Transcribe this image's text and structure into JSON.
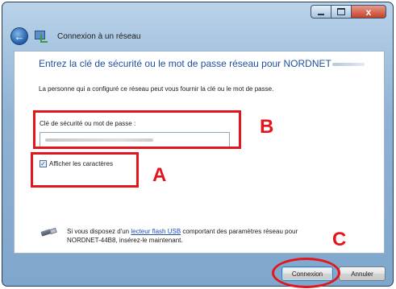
{
  "window": {
    "title": "Connexion à un réseau",
    "controls": {
      "close_glyph": "x"
    }
  },
  "content": {
    "instruction": "Entrez la clé de sécurité ou le mot de passe réseau pour NORDNET",
    "description": "La personne qui a configuré ce réseau peut vous fournir la clé ou le mot de passe.",
    "field_label": "Clé de sécurité ou mot de passe :",
    "show_chars": {
      "label": "Afficher les caractères",
      "checked": true,
      "check_glyph": "✓"
    },
    "usb": {
      "prefix": "Si vous disposez d'un ",
      "link": "lecteur flash USB",
      "suffix": " comportant des paramètres réseau pour",
      "line2": "NORDNET-44B8, insérez-le maintenant."
    }
  },
  "footer": {
    "connect_label": "Connexion",
    "cancel_label": "Annuler"
  },
  "annotations": {
    "a": "A",
    "b": "B",
    "c": "C"
  },
  "colors": {
    "annotation_red": "#e3151d",
    "instruction_blue": "#1e4fa0",
    "link_blue": "#1f4fb3"
  },
  "icons": {
    "back": "back-arrow-icon",
    "network": "network-icon",
    "usb": "usb-drive-icon"
  }
}
